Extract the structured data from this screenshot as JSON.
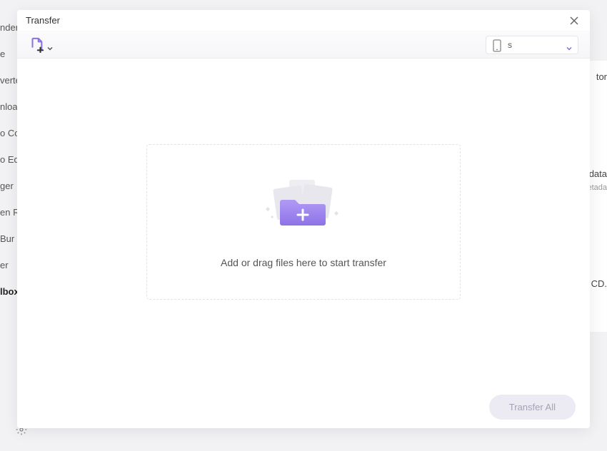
{
  "modal": {
    "title": "Transfer",
    "close_label": "Close"
  },
  "toolbar": {
    "add_file_label": "Add File",
    "device_selected": "s"
  },
  "dropzone": {
    "instruction": "Add or drag files here to start transfer"
  },
  "footer": {
    "transfer_all_label": "Transfer All"
  },
  "background": {
    "left_items": [
      "nder",
      "e",
      "verte",
      "nloa",
      "o Co",
      "o Ed",
      "ger",
      "en R",
      "Bur",
      "er"
    ],
    "left_bold": "lbox",
    "right_items": [
      "tor",
      "data",
      "etada",
      "CD."
    ]
  },
  "colors": {
    "accent": "#8a6fe8",
    "accent_light": "#a78bfa",
    "muted": "#eceaf3"
  }
}
